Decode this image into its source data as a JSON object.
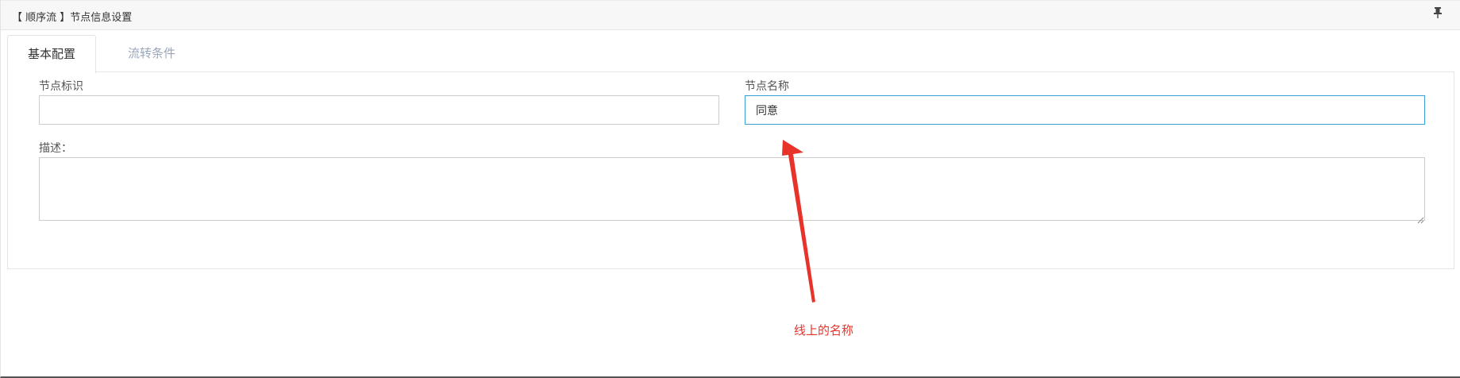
{
  "panel": {
    "title": "【 顺序流 】节点信息设置",
    "pin_icon": "pin-icon"
  },
  "tabs": [
    {
      "label": "基本配置",
      "active": true
    },
    {
      "label": "流转条件",
      "active": false
    }
  ],
  "form": {
    "node_id": {
      "label": "节点标识",
      "value": ""
    },
    "node_name": {
      "label": "节点名称",
      "value": "同意"
    },
    "description": {
      "label": "描述：",
      "value": ""
    }
  },
  "annotation": {
    "text": "线上的名称",
    "color": "#e8332b"
  },
  "colors": {
    "focus_border": "#3aa0d8",
    "inactive_tab": "#9aa7b8",
    "header_bg": "#f7f7f7"
  }
}
